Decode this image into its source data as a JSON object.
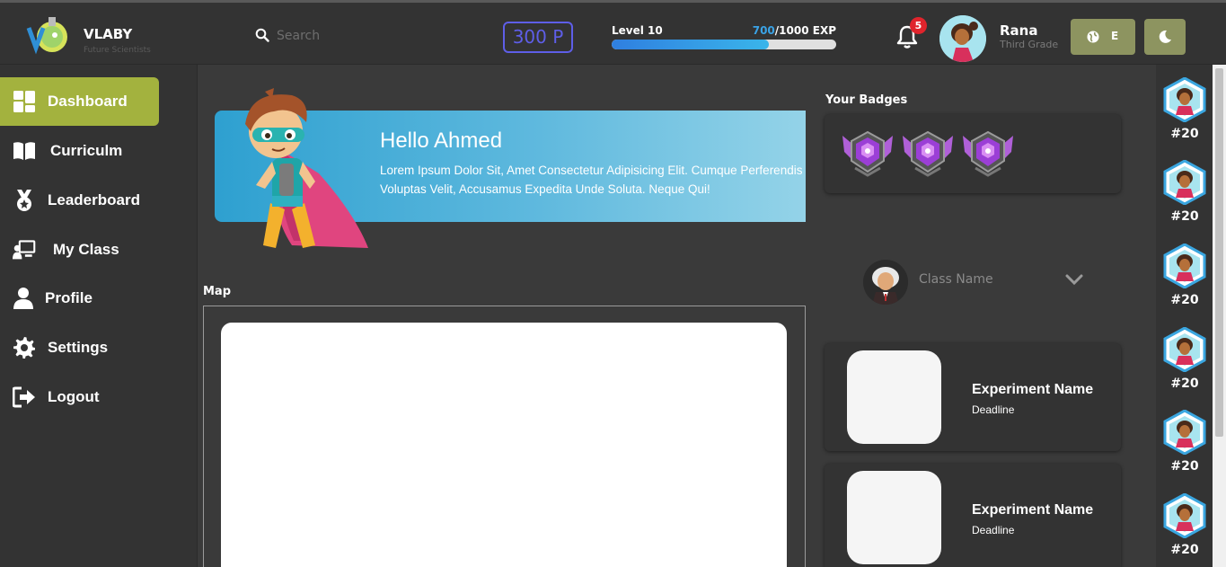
{
  "app": {
    "brand": "VLABY",
    "tagline": "Future Scientists"
  },
  "header": {
    "search_placeholder": "Search",
    "points": "300 P",
    "level": "Level 10",
    "exp_current": "700",
    "exp_total": "/1000 EXP",
    "exp_progress": 0.7,
    "notifications_count": "5",
    "user_name": "Rana",
    "user_grade": "Third Grade",
    "language": "E",
    "accent_color": "#8d9460"
  },
  "sidebar": {
    "items": [
      {
        "label": "Dashboard",
        "icon": "dashboard-icon",
        "active": true
      },
      {
        "label": "Curriculm",
        "icon": "book-icon",
        "active": false
      },
      {
        "label": "Leaderboard",
        "icon": "medal-icon",
        "active": false
      },
      {
        "label": "My Class",
        "icon": "class-icon",
        "active": false
      },
      {
        "label": "Profile",
        "icon": "user-icon",
        "active": false
      },
      {
        "label": "Settings",
        "icon": "gear-icon",
        "active": false
      },
      {
        "label": "Logout",
        "icon": "logout-icon",
        "active": false
      }
    ],
    "active_color": "#a3b23e"
  },
  "welcome": {
    "title": "Hello Ahmed",
    "text": "Lorem Ipsum Dolor Sit, Amet Consectetur Adipisicing Elit. Cumque Perferendis Voluptas Velit, Accusamus Expedita Unde Soluta. Neque Qui!"
  },
  "map": {
    "label": "Map"
  },
  "badges": {
    "label": "Your Badges",
    "count": 3
  },
  "class_select": {
    "placeholder": "Class Name"
  },
  "experiments": [
    {
      "name": "Experiment Name",
      "deadline": "Deadline"
    },
    {
      "name": "Experiment Name",
      "deadline": "Deadline"
    }
  ],
  "leaderboard_rail": [
    {
      "rank": "#20"
    },
    {
      "rank": "#20"
    },
    {
      "rank": "#20"
    },
    {
      "rank": "#20"
    },
    {
      "rank": "#20"
    },
    {
      "rank": "#20"
    }
  ]
}
